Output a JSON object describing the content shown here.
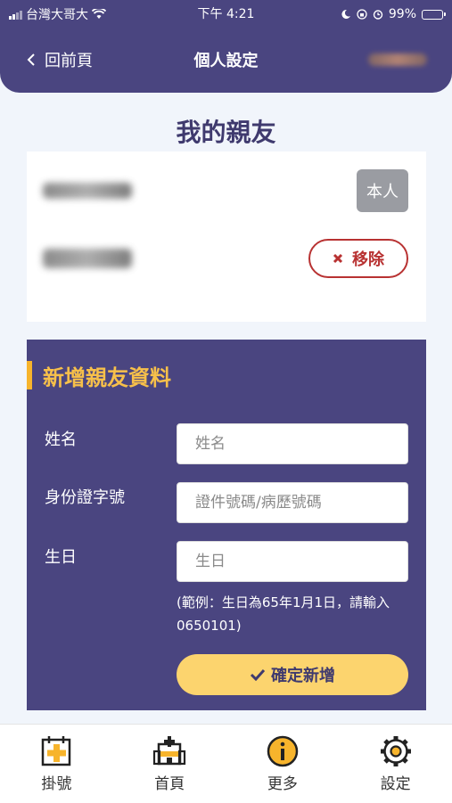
{
  "status_bar": {
    "carrier": "台灣大哥大",
    "time": "下午 4:21",
    "battery": "99%",
    "battery_level": 0.99
  },
  "header": {
    "back_label": "回前頁",
    "title": "個人設定"
  },
  "page_title": "我的親友",
  "friends": {
    "self_badge": "本人",
    "remove_label": "移除"
  },
  "form": {
    "heading": "新增親友資料",
    "name_label": "姓名",
    "name_placeholder": "姓名",
    "id_label": "身份證字號",
    "id_placeholder": "證件號碼/病歷號碼",
    "birth_label": "生日",
    "birth_placeholder": "生日",
    "hint": "(範例：生日為65年1月1日，請輸入0650101)",
    "confirm_label": "確定新增"
  },
  "tabbar": {
    "items": [
      {
        "label": "掛號",
        "icon": "calendar-plus-icon"
      },
      {
        "label": "首頁",
        "icon": "hospital-icon"
      },
      {
        "label": "更多",
        "icon": "info-icon"
      },
      {
        "label": "設定",
        "icon": "gear-icon"
      }
    ]
  },
  "colors": {
    "brand_purple": "#4a4580",
    "accent_yellow": "#fcd46e",
    "heading_orange": "#f7c04a",
    "remove_red": "#b83232"
  }
}
